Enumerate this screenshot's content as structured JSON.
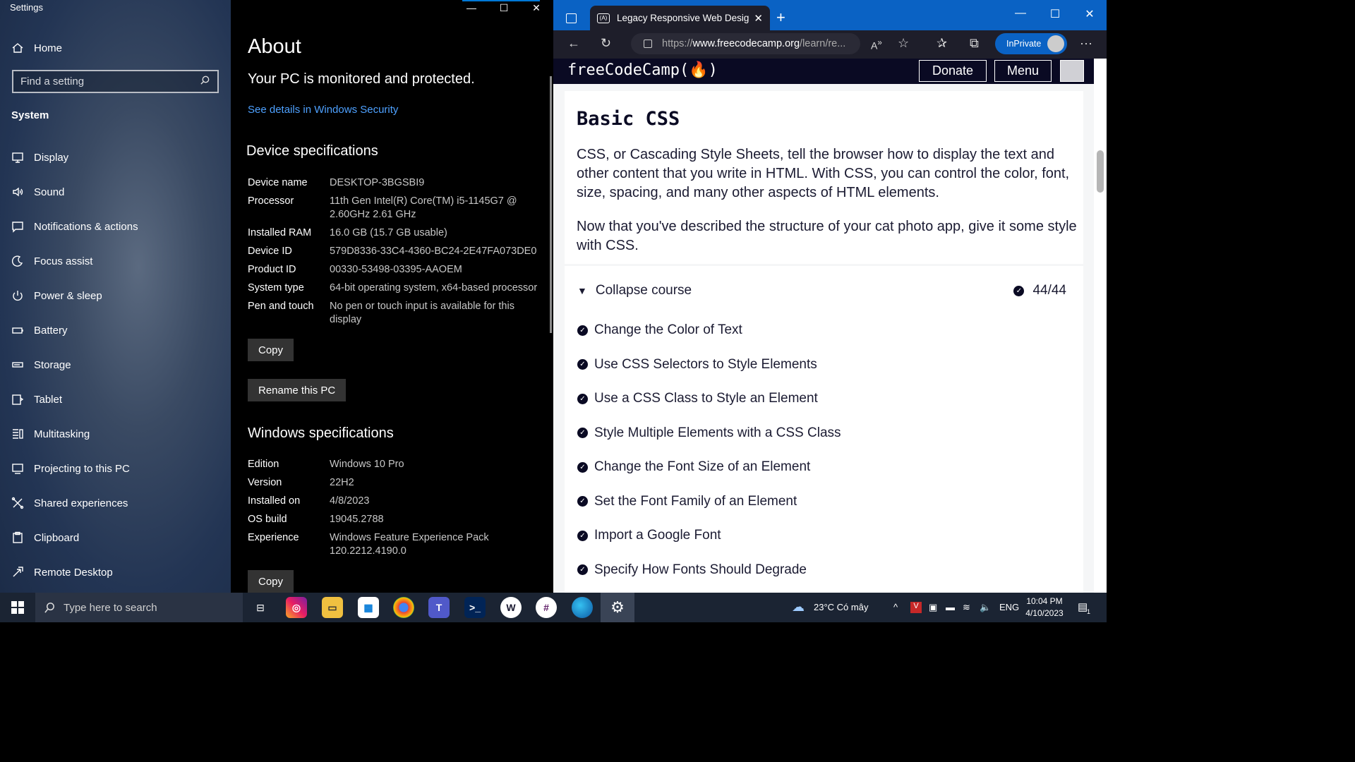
{
  "settings": {
    "app_title": "Settings",
    "home_label": "Home",
    "search_placeholder": "Find a setting",
    "section": "System",
    "nav": [
      {
        "label": "Display",
        "icon": "monitor-icon"
      },
      {
        "label": "Sound",
        "icon": "speaker-icon"
      },
      {
        "label": "Notifications & actions",
        "icon": "notification-icon"
      },
      {
        "label": "Focus assist",
        "icon": "moon-icon"
      },
      {
        "label": "Power & sleep",
        "icon": "power-icon"
      },
      {
        "label": "Battery",
        "icon": "battery-icon"
      },
      {
        "label": "Storage",
        "icon": "storage-icon"
      },
      {
        "label": "Tablet",
        "icon": "tablet-icon"
      },
      {
        "label": "Multitasking",
        "icon": "multitasking-icon"
      },
      {
        "label": "Projecting to this PC",
        "icon": "projector-icon"
      },
      {
        "label": "Shared experiences",
        "icon": "shared-icon"
      },
      {
        "label": "Clipboard",
        "icon": "clipboard-icon"
      },
      {
        "label": "Remote Desktop",
        "icon": "remote-desktop-icon"
      }
    ]
  },
  "about": {
    "title": "About",
    "protected": "Your PC is monitored and protected.",
    "security_link": "See details in Windows Security",
    "device_heading": "Device specifications",
    "device_specs": [
      {
        "key": "Device name",
        "value": "DESKTOP-3BGSBI9"
      },
      {
        "key": "Processor",
        "value": "11th Gen Intel(R) Core(TM) i5-1145G7 @ 2.60GHz   2.61 GHz"
      },
      {
        "key": "Installed RAM",
        "value": "16.0 GB (15.7 GB usable)"
      },
      {
        "key": "Device ID",
        "value": "579D8336-33C4-4360-BC24-2E47FA073DE0"
      },
      {
        "key": "Product ID",
        "value": "00330-53498-03395-AAOEM"
      },
      {
        "key": "System type",
        "value": "64-bit operating system, x64-based processor"
      },
      {
        "key": "Pen and touch",
        "value": "No pen or touch input is available for this display"
      }
    ],
    "copy_label": "Copy",
    "rename_label": "Rename this PC",
    "windows_heading": "Windows specifications",
    "windows_specs": [
      {
        "key": "Edition",
        "value": "Windows 10 Pro"
      },
      {
        "key": "Version",
        "value": "22H2"
      },
      {
        "key": "Installed on",
        "value": "4/8/2023"
      },
      {
        "key": "OS build",
        "value": "19045.2788"
      },
      {
        "key": "Experience",
        "value": "Windows Feature Experience Pack 120.2212.4190.0"
      }
    ],
    "copy2_label": "Copy",
    "window_controls": {
      "minimize": "—",
      "maximize": "☐",
      "close": "✕"
    }
  },
  "browser": {
    "tab_title": "Legacy Responsive Web Design C",
    "tab_favicon": "(A)",
    "url_prefix": "https://",
    "url_host": "www.freecodecamp.org",
    "url_path": "/learn/re...",
    "inprivate_label": "InPrivate",
    "window_controls": {
      "minimize": "—",
      "maximize": "☐",
      "close": "✕"
    },
    "fcc": {
      "logo": "freeCodeCamp(🔥)",
      "donate": "Donate",
      "menu": "Menu",
      "heading": "Basic CSS",
      "paragraph1": "CSS, or Cascading Style Sheets, tell the browser how to display the text and other content that you write in HTML. With CSS, you can control the color, font, size, spacing, and many other aspects of HTML elements.",
      "paragraph2": "Now that you've described the structure of your cat photo app, give it some style with CSS.",
      "collapse_label": "Collapse course",
      "progress": "44/44",
      "lessons": [
        "Change the Color of Text",
        "Use CSS Selectors to Style Elements",
        "Use a CSS Class to Style an Element",
        "Style Multiple Elements with a CSS Class",
        "Change the Font Size of an Element",
        "Set the Font Family of an Element",
        "Import a Google Font",
        "Specify How Fonts Should Degrade"
      ]
    }
  },
  "taskbar": {
    "search_placeholder": "Type here to search",
    "weather": "23°C  Có mây",
    "language": "ENG",
    "time": "10:04 PM",
    "date": "4/10/2023",
    "notification_count": "1",
    "accent": "#0078d7"
  }
}
